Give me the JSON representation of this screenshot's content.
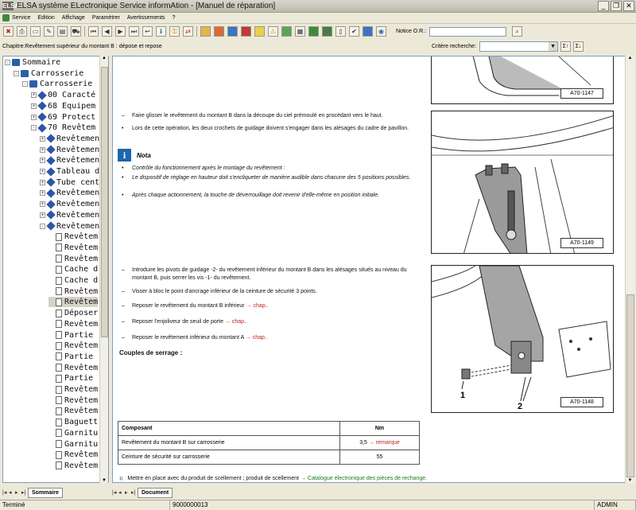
{
  "window": {
    "title": "ELSA système ELectronique Service informAtion - [Manuel de réparation]",
    "logo": "ELSA"
  },
  "menu": [
    "Service",
    "Edition",
    "Affichage",
    "Paramètrer",
    "Avertissements",
    "?"
  ],
  "toolbar": {
    "notice_label": "Notice O.R.:",
    "notice_value": ""
  },
  "chapter_bar": {
    "chapter": "Chapitre:Revêtement supérieur du montant B : dépose et repose",
    "criteria_label": "Critère recherche:",
    "criteria_value": ""
  },
  "tree": [
    {
      "level": 0,
      "icon": "book",
      "pm": "-",
      "label": "Sommaire"
    },
    {
      "level": 1,
      "icon": "book",
      "pm": "-",
      "label": "Carrosserie"
    },
    {
      "level": 2,
      "icon": "book",
      "pm": "-",
      "label": "Carrosserie"
    },
    {
      "level": 3,
      "icon": "diamond",
      "pm": "+",
      "label": "00 Caracté"
    },
    {
      "level": 3,
      "icon": "diamond",
      "pm": "+",
      "label": "68 Equipem"
    },
    {
      "level": 3,
      "icon": "diamond",
      "pm": "+",
      "label": "69 Protect"
    },
    {
      "level": 3,
      "icon": "diamond",
      "pm": "-",
      "label": "70 Revêtem"
    },
    {
      "level": 4,
      "icon": "diamond",
      "pm": "+",
      "label": "Revêtemen"
    },
    {
      "level": 4,
      "icon": "diamond",
      "pm": "+",
      "label": "Revêtemen"
    },
    {
      "level": 4,
      "icon": "diamond",
      "pm": "+",
      "label": "Revêtemen"
    },
    {
      "level": 4,
      "icon": "diamond",
      "pm": "+",
      "label": "Tableau d"
    },
    {
      "level": 4,
      "icon": "diamond",
      "pm": "+",
      "label": "Tube cent"
    },
    {
      "level": 4,
      "icon": "diamond",
      "pm": "+",
      "label": "Revêtemen"
    },
    {
      "level": 4,
      "icon": "diamond",
      "pm": "+",
      "label": "Revêtemen"
    },
    {
      "level": 4,
      "icon": "diamond",
      "pm": "+",
      "label": "Revêtemen"
    },
    {
      "level": 4,
      "icon": "diamond",
      "pm": "-",
      "label": "Revêtemen"
    },
    {
      "level": 5,
      "icon": "page",
      "pm": "",
      "label": "Revêtem"
    },
    {
      "level": 5,
      "icon": "page",
      "pm": "",
      "label": "Revêtem"
    },
    {
      "level": 5,
      "icon": "page",
      "pm": "",
      "label": "Revêtem"
    },
    {
      "level": 5,
      "icon": "page",
      "pm": "",
      "label": "Cache d"
    },
    {
      "level": 5,
      "icon": "page",
      "pm": "",
      "label": "Cache d"
    },
    {
      "level": 5,
      "icon": "page",
      "pm": "",
      "label": "Revêtem"
    },
    {
      "level": 5,
      "icon": "page",
      "pm": "",
      "label": "Revêtem",
      "selected": true
    },
    {
      "level": 5,
      "icon": "page",
      "pm": "",
      "label": "Déposer"
    },
    {
      "level": 5,
      "icon": "page",
      "pm": "",
      "label": "Revêtem"
    },
    {
      "level": 5,
      "icon": "page",
      "pm": "",
      "label": "Partie"
    },
    {
      "level": 5,
      "icon": "page",
      "pm": "",
      "label": "Revêtem"
    },
    {
      "level": 5,
      "icon": "page",
      "pm": "",
      "label": "Partie"
    },
    {
      "level": 5,
      "icon": "page",
      "pm": "",
      "label": "Revêtem"
    },
    {
      "level": 5,
      "icon": "page",
      "pm": "",
      "label": "Partie"
    },
    {
      "level": 5,
      "icon": "page",
      "pm": "",
      "label": "Revêtem"
    },
    {
      "level": 5,
      "icon": "page",
      "pm": "",
      "label": "Revêtem"
    },
    {
      "level": 5,
      "icon": "page",
      "pm": "",
      "label": "Revêtem"
    },
    {
      "level": 5,
      "icon": "page",
      "pm": "",
      "label": "Baguett"
    },
    {
      "level": 5,
      "icon": "page",
      "pm": "",
      "label": "Garnitu"
    },
    {
      "level": 5,
      "icon": "page",
      "pm": "",
      "label": "Garnitu"
    },
    {
      "level": 5,
      "icon": "page",
      "pm": "",
      "label": "Revêtem"
    },
    {
      "level": 5,
      "icon": "page",
      "pm": "",
      "label": "Revêtem"
    }
  ],
  "tree_tab": "Sommaire",
  "doc_tab": "Document",
  "content": {
    "step1": "Faire glisser le revêtement du montant B dans la découpe du ciel prémoulé en procédant vers le haut.",
    "bullet1": "Lors de cette opération, les deux crochets de guidage doivent s'engager dans les alésages du cadre de pavillon.",
    "nota_icon": "i",
    "nota_label": "Nota",
    "nota_items": [
      "Contrôle du fonctionnement après le montage du revêtement :",
      "Le dispositif de réglage en hauteur doit s'encliqueter de manière audible dans chacune des 5 positions possibles.",
      "Après chaque actionnement, la touche de déverrouillage doit revenir d'elle-même en position initiale."
    ],
    "step2": "Introduire les pivots de guidage -2- du revêtement inférieur du montant B dans les alésages situés au niveau du montant B, puis serrer les vis -1- du revêtement.",
    "step3": "Visser à bloc le point d'ancrage inférieur de la ceinture de sécurité 3 points.",
    "step4": "Reposer le revêtement du montant B inférieur",
    "step5": "Reposer l'enjoliveur de seuil de porte",
    "step6": "Reposer le revêtement inférieur du montant A",
    "link": "→ chap..",
    "torque_heading": "Couples de serrage :",
    "torque_header": [
      "Composant",
      "Nm"
    ],
    "torque_rows": [
      {
        "component": "Revêtement du montant B sur carrosserie",
        "nm": "3,5",
        "note": "→ remarque"
      },
      {
        "component": "Ceinture de sécurité sur carrosserie",
        "nm": "55",
        "note": ""
      }
    ],
    "footnote_mark": "1)",
    "footnote": "Mettre en place avec du produit de scellement ; produit de scellement",
    "footnote_link": "→ Catalogue électronique des pièces de rechange.",
    "fig_ids": [
      "A70-1147",
      "A70-1149",
      "A70-1148"
    ],
    "fig_callouts": [
      "1",
      "2"
    ],
    "dash": "–",
    "bullet": "•"
  },
  "status": {
    "left": "Terminé",
    "number": "9000000013",
    "user": "ADMIN"
  }
}
